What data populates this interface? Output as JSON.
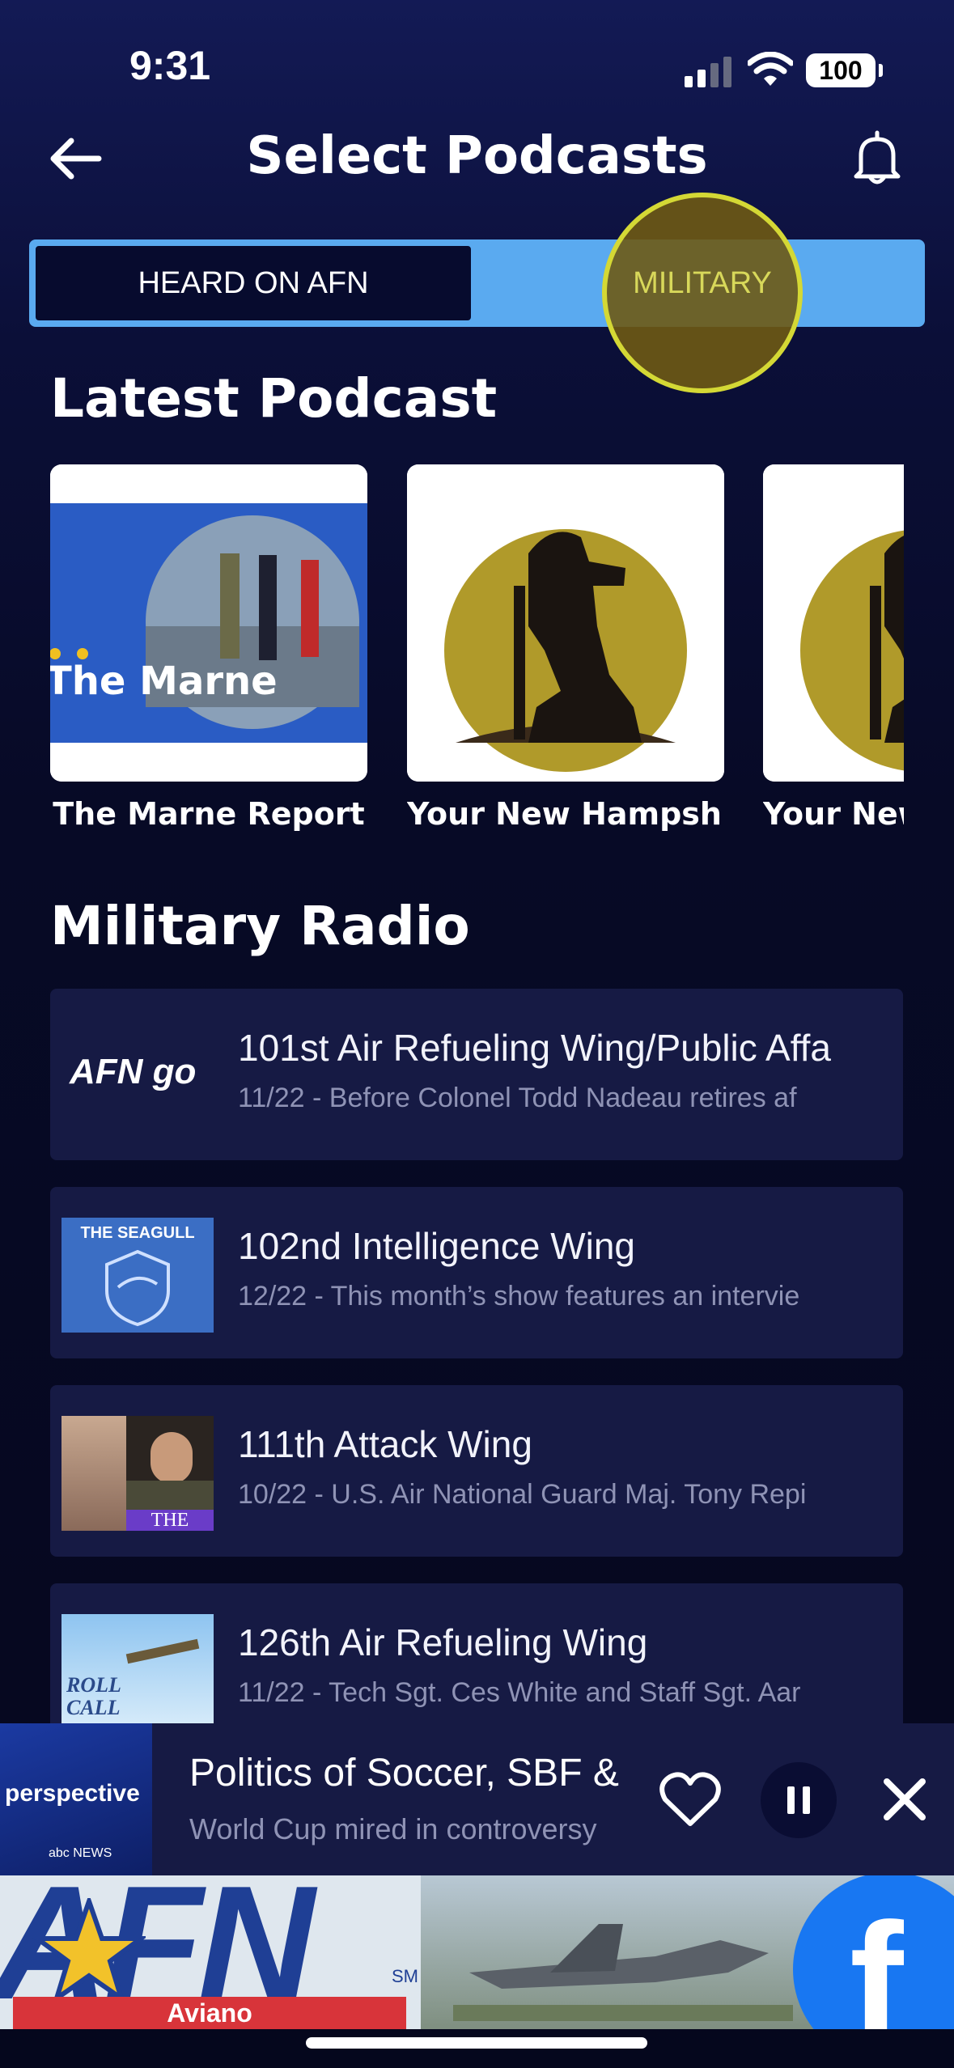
{
  "status_bar": {
    "time": "9:31",
    "battery": "100"
  },
  "header": {
    "title": "Select Podcasts"
  },
  "segments": {
    "left": "HEARD ON AFN",
    "right": "MILITARY"
  },
  "latest": {
    "title": "Latest Podcast",
    "cards": [
      {
        "label": "The Marne Report",
        "thumb_text": "The Marne"
      },
      {
        "label": "Your New Hampshi…"
      },
      {
        "label": "Your New"
      }
    ]
  },
  "military": {
    "title": "Military Radio",
    "items": [
      {
        "title": "101st Air Refueling Wing/Public Affa",
        "subtitle": "11/22 - Before Colonel Todd Nadeau retires af",
        "thumb": "AFN go"
      },
      {
        "title": "102nd Intelligence Wing",
        "subtitle": "12/22 - This month’s show features an intervie",
        "thumb": "THE SEAGULL"
      },
      {
        "title": "111th Attack Wing",
        "subtitle": "10/22 - U.S. Air National Guard Maj. Tony Repi",
        "thumb": "THE"
      },
      {
        "title": "126th Air Refueling Wing",
        "subtitle": "11/22 - Tech Sgt. Ces White and Staff Sgt. Aar",
        "thumb": "ROLL CALL"
      }
    ]
  },
  "player": {
    "title": "Politics of Soccer, SBF &",
    "subtitle": "World Cup mired in controversy",
    "thumb_text": "perspective",
    "thumb_sub": "abc NEWS"
  },
  "ad": {
    "brand": "AFN",
    "mark": "SM",
    "location": "Aviano"
  },
  "colors": {
    "accent": "#5aaaf0",
    "highlight": "#d4d835",
    "card_bg": "#161a44"
  }
}
